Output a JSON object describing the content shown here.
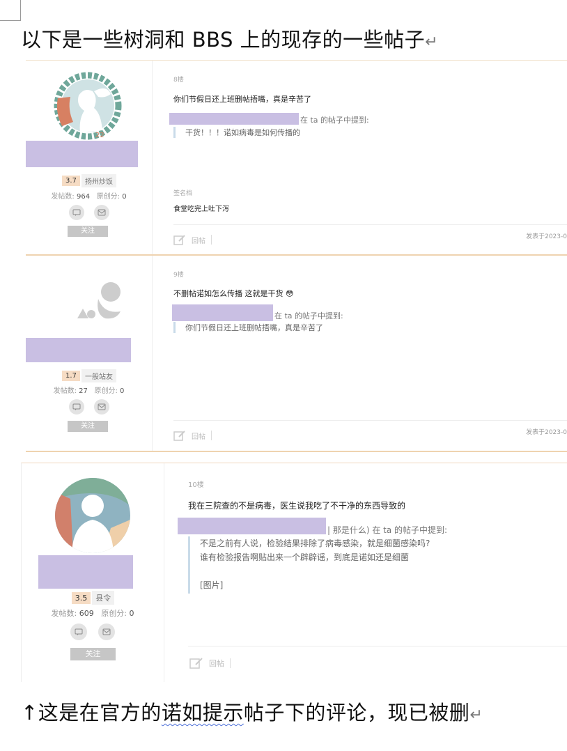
{
  "heading": "以下是一些树洞和 BBS 上的现存的一些帖子",
  "caption": {
    "before": "↑这是在官方的",
    "underlined": "诺如提示",
    "after": "帖子下的评论，现已被删"
  },
  "paragraph_mark": "↵",
  "posts": [
    {
      "user": {
        "rank_level": "3.7",
        "rank_title": "扬州炒饭",
        "posts_label": "发帖数:",
        "posts_count": "964",
        "orig_label": "原创分:",
        "orig_score": "0"
      },
      "follow": "关注",
      "floor": "8楼",
      "text": "你们节假日还上班删帖捂嘴，真是辛苦了",
      "quote_mention": "在 ta 的帖子中提到:",
      "quote_lines": [
        "干货！！！诺如病毒是如何传播的"
      ],
      "signature_label": "签名档",
      "signature": "食堂吃完上吐下泻",
      "reply": "回帖",
      "date": "发表于2023-0"
    },
    {
      "user": {
        "rank_level": "1.7",
        "rank_title": "一般站友",
        "posts_label": "发帖数:",
        "posts_count": "27",
        "orig_label": "原创分:",
        "orig_score": "0"
      },
      "follow": "关注",
      "floor": "9楼",
      "text": "不删帖诺如怎么传播 这就是干货",
      "emoji": "😳",
      "quote_mention": "在 ta 的帖子中提到:",
      "quote_lines": [
        "你们节假日还上班删帖捂嘴，真是辛苦了"
      ],
      "reply": "回帖",
      "date": "发表于2023-0"
    },
    {
      "user": {
        "rank_level": "3.5",
        "rank_title": "县令",
        "posts_label": "发帖数:",
        "posts_count": "609",
        "orig_label": "原创分:",
        "orig_score": "0"
      },
      "follow": "关注",
      "floor": "10楼",
      "text": "我在三院查的不是病毒，医生说我吃了不干净的东西导致的",
      "quote_mention": "| 那是什么) 在 ta 的帖子中提到:",
      "quote_lines": [
        "不是之前有人说，检验结果排除了病毒感染，就是细菌感染吗?",
        "谁有检验报告啊贴出来一个辟辟谣，到底是诺如还是细菌",
        "",
        "[图片]"
      ],
      "reply": "回帖"
    }
  ],
  "colors": {
    "redaction": "#c9bfe3",
    "rank_badge": "#f6dcc4",
    "quote_border": "#c9dbe9",
    "divider_gold": "#efd3b0"
  }
}
